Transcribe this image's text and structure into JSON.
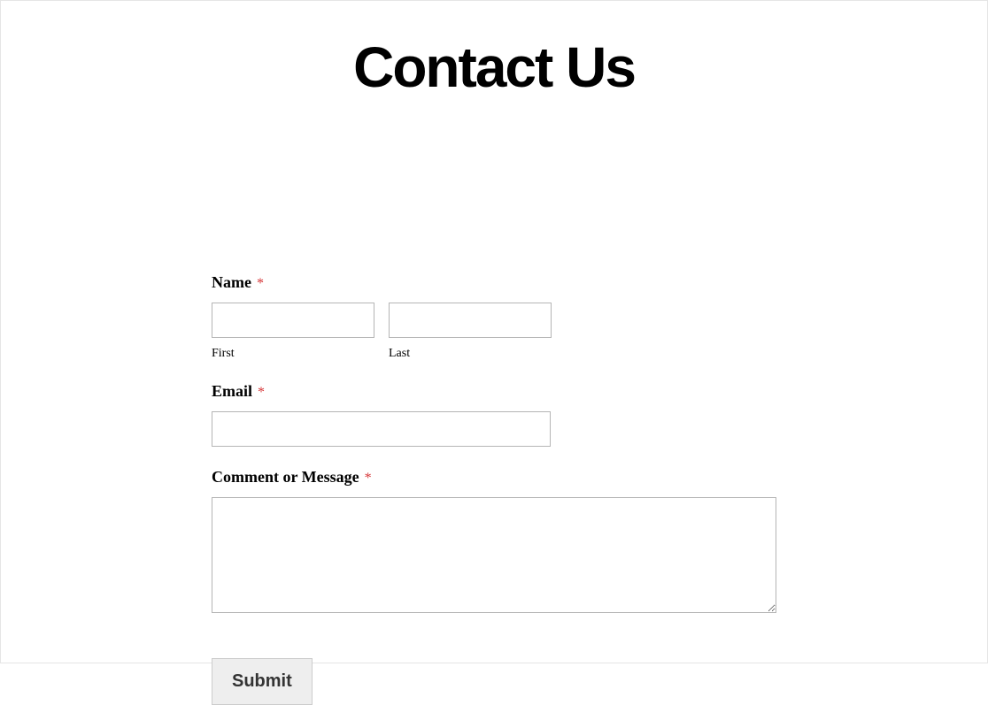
{
  "title": "Contact Us",
  "form": {
    "name": {
      "label": "Name",
      "required_marker": "*",
      "first_sublabel": "First",
      "last_sublabel": "Last",
      "first_value": "",
      "last_value": ""
    },
    "email": {
      "label": "Email",
      "required_marker": "*",
      "value": ""
    },
    "comment": {
      "label": "Comment or Message",
      "required_marker": "*",
      "value": ""
    },
    "submit_label": "Submit"
  }
}
